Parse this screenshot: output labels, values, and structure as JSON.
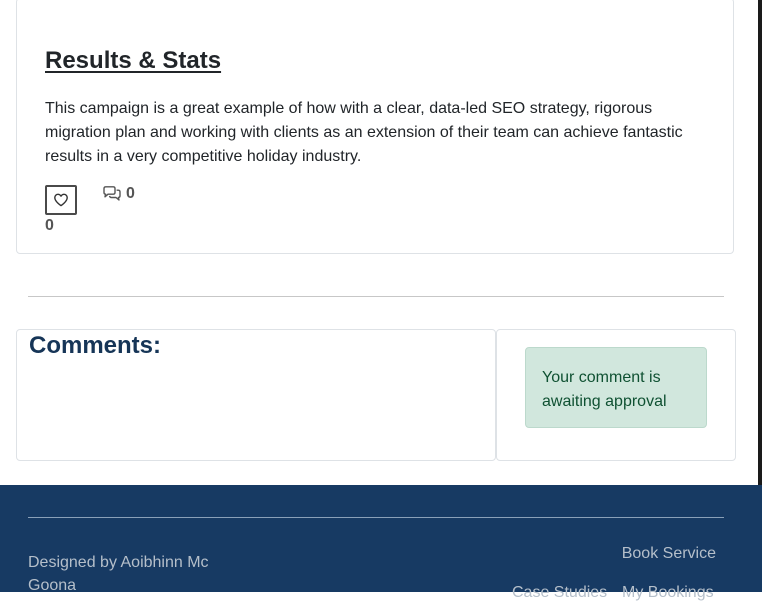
{
  "post": {
    "title": "Results & Stats",
    "body": "This campaign is a great example of how with a clear, data-led SEO strategy, rigorous migration plan and working with clients as an extension of their team can achieve fantastic results in a very competitive holiday industry.",
    "like_count": "0",
    "comment_count": "0"
  },
  "comments": {
    "heading": "Comments:",
    "status_message": "Your comment is awaiting approval"
  },
  "footer": {
    "credit": "Designed by Aoibhinn Mc Goona",
    "links": {
      "book_service": "Book Service",
      "case_studies": "Case Studies",
      "my_bookings": "My Bookings"
    }
  },
  "colors": {
    "heading_navy": "#163557",
    "footer_background": "#173a63",
    "alert_background": "#d1e7dd",
    "alert_text": "#0f5132"
  }
}
